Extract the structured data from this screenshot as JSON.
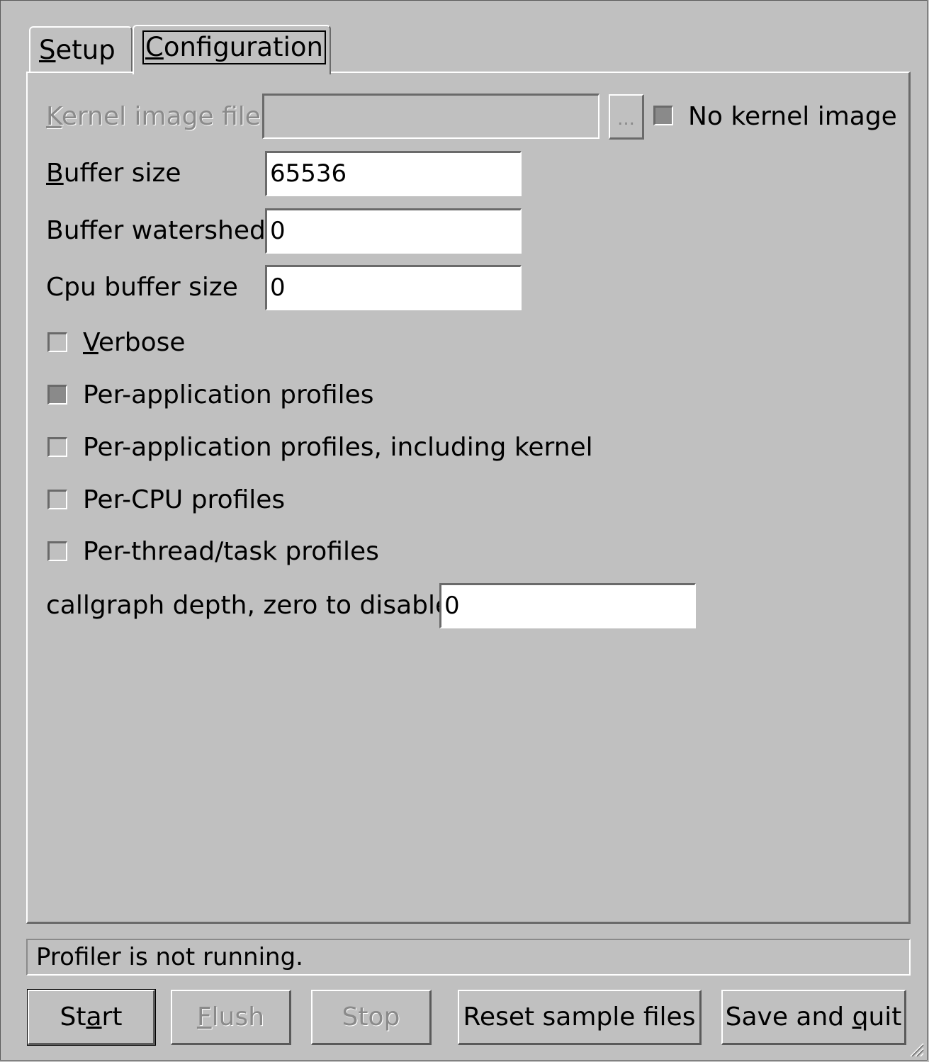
{
  "tabs": {
    "setup": {
      "pre": "",
      "accel": "S",
      "post": "etup"
    },
    "configuration": {
      "pre": "",
      "accel": "C",
      "post": "onfiguration"
    }
  },
  "kernel_image": {
    "label_accel": "K",
    "label_rest": "ernel image file",
    "value": "",
    "browse_label": "...",
    "no_kernel_label": "No kernel image",
    "no_kernel_checked": true
  },
  "fields": {
    "buffer_size": {
      "label_accel": "B",
      "label_rest": "uffer size",
      "value": "65536"
    },
    "buffer_watershed": {
      "label": "Buffer watershed",
      "value": "0"
    },
    "cpu_buffer_size": {
      "label": "Cpu buffer size",
      "value": "0"
    },
    "callgraph_depth": {
      "label": "callgraph depth, zero to disable",
      "value": "0"
    }
  },
  "options": {
    "verbose": {
      "accel": "V",
      "rest": "erbose",
      "checked": false
    },
    "per_app": {
      "label": "Per-application profiles",
      "checked": true
    },
    "per_app_kernel": {
      "label": "Per-application profiles, including kernel",
      "checked": false
    },
    "per_cpu": {
      "label": "Per-CPU profiles",
      "checked": false
    },
    "per_thread": {
      "label": "Per-thread/task profiles",
      "checked": false
    }
  },
  "status": "Profiler is not running.",
  "buttons": {
    "start": {
      "pre": "St",
      "accel": "a",
      "post": "rt"
    },
    "flush": {
      "pre": "",
      "accel": "F",
      "post": "lush"
    },
    "stop": {
      "label": "Stop"
    },
    "reset": {
      "label": "Reset sample files"
    },
    "save_quit": {
      "pre": "Save and ",
      "accel": "q",
      "post": "uit"
    }
  }
}
